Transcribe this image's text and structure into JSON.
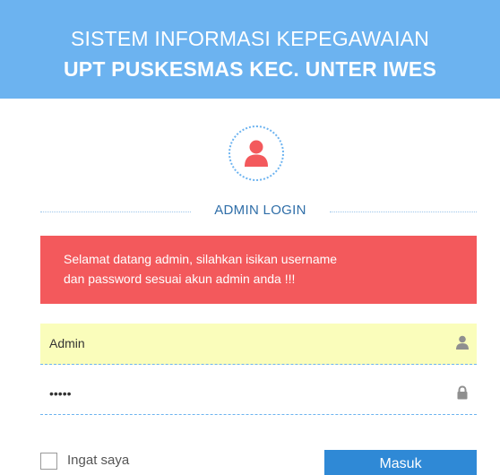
{
  "header": {
    "line1": "SISTEM INFORMASI KEPEGAWAIAN",
    "line2": "UPT PUSKESMAS KEC. UNTER IWES"
  },
  "avatar": {
    "icon": "user-icon",
    "icon_color": "#f3595c",
    "ring_color": "#6cb3f0"
  },
  "login": {
    "title": "ADMIN LOGIN"
  },
  "alert": {
    "line1": "Selamat datang admin, silahkan isikan username",
    "line2": "dan password sesuai akun admin anda !!!",
    "color": "#f3595c"
  },
  "form": {
    "username": {
      "value": "Admin",
      "icon": "user-icon"
    },
    "password": {
      "value": "•••••",
      "icon": "lock-icon"
    },
    "remember_label": "Ingat saya",
    "submit_label": "Masuk"
  },
  "colors": {
    "header": "#6cb3f0",
    "button": "#2f89d6",
    "username_bg": "#fafdbb"
  }
}
